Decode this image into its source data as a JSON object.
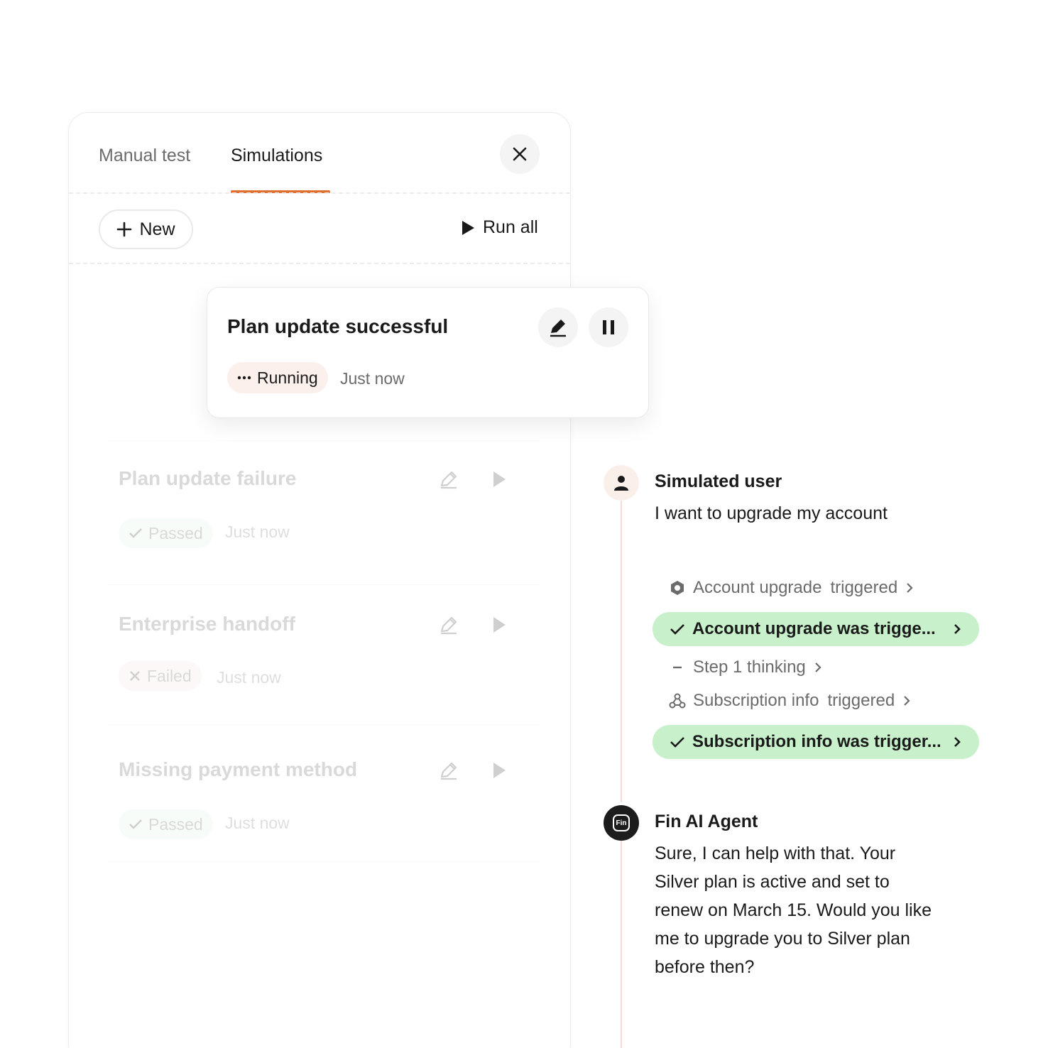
{
  "tabs": {
    "manual": "Manual test",
    "simulations": "Simulations"
  },
  "toolbar": {
    "new_label": "New",
    "run_all_label": "Run all"
  },
  "active": {
    "title": "Plan update successful",
    "status": "Running",
    "time": "Just now"
  },
  "items": [
    {
      "title": "Plan update failure",
      "status": "Passed",
      "time": "Just now"
    },
    {
      "title": "Enterprise handoff",
      "status": "Failed",
      "time": "Just now"
    },
    {
      "title": "Missing payment method",
      "status": "Passed",
      "time": "Just now"
    }
  ],
  "timeline": {
    "user_label": "Simulated user",
    "user_message": "I want to upgrade my account",
    "steps": {
      "s1_main": "Account upgrade",
      "s1_sub": "triggered",
      "s2": "Account upgrade was trigge...",
      "s3": "Step 1 thinking",
      "s4_main": "Subscription info",
      "s4_sub": "triggered",
      "s5": "Subscription info was trigger..."
    },
    "agent_label": "Fin AI Agent",
    "agent_badge": "Fin",
    "agent_lines": [
      "Sure, I can help with that. Your",
      "Silver plan is active and set to",
      "renew on March 15. Would you like",
      "me to upgrade you to Silver plan",
      "before then?"
    ]
  },
  "colors": {
    "accent": "#e0702f",
    "success_bg": "#c8f0cb",
    "running_bg": "#fbf0ec"
  }
}
